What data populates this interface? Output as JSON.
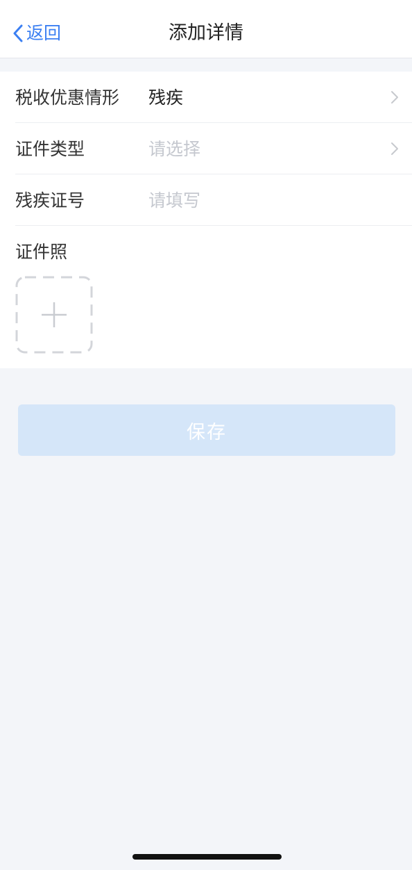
{
  "navbar": {
    "back_label": "返回",
    "title": "添加详情"
  },
  "form": {
    "tax_situation": {
      "label": "税收优惠情形",
      "value": "残疾"
    },
    "id_type": {
      "label": "证件类型",
      "placeholder": "请选择"
    },
    "disability_no": {
      "label": "残疾证号",
      "placeholder": "请填写",
      "value": ""
    },
    "photo": {
      "label": "证件照"
    }
  },
  "actions": {
    "save_label": "保存"
  },
  "colors": {
    "accent": "#3b7ff2",
    "background": "#f3f5f9",
    "save_button_bg": "#d5e6f9",
    "placeholder": "#c5c8cf"
  }
}
